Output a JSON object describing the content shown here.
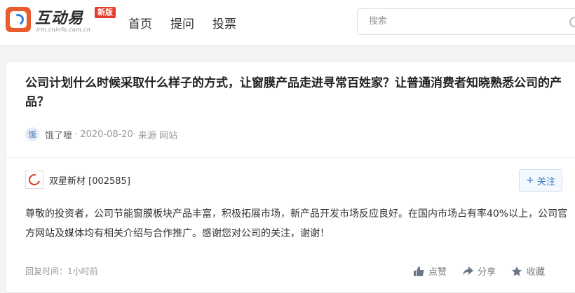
{
  "header": {
    "logo": {
      "name": "互动易",
      "badge": "新版",
      "domain": "irm.cninfo.com.cn"
    },
    "nav": [
      "首页",
      "提问",
      "投票"
    ],
    "search": {
      "placeholder": "搜索"
    }
  },
  "question": {
    "title": "公司计划什么时候采取什么样子的方式，让窗膜产品走进寻常百姓家？让普通消费者知晓熟悉公司的产品？",
    "avatar_char": "饿",
    "author": "饿了嚒",
    "date": "· 2020-08-20·",
    "source": "来源 网站"
  },
  "answer": {
    "company": "双星新材 [002585]",
    "follow_label": "关注",
    "follow_icon": "+",
    "text": "尊敬的投资者，公司节能窗膜板块产品丰富，积极拓展市场，新产品开发市场反应良好。在国内市场占有率40%以上，公司官方网站及媒体均有相关介绍与合作推广。感谢您对公司的关注，谢谢！",
    "reply_time": "回复时间：1小时前",
    "actions": {
      "like": "点赞",
      "share": "分享",
      "collect": "收藏"
    }
  },
  "colors": {
    "accent": "#3a78c4",
    "brand": "#e95b2b",
    "badge": "#e23d2e"
  }
}
